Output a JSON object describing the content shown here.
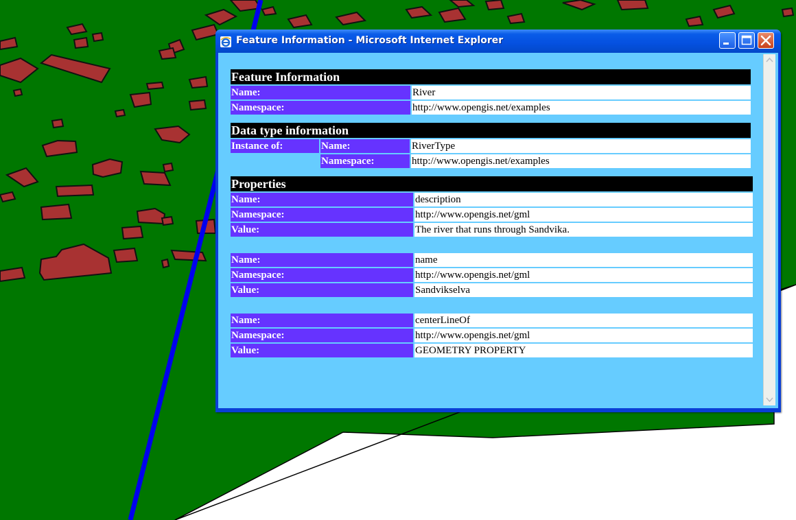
{
  "window": {
    "title": "Feature Information - Microsoft Internet Explorer",
    "icon": "ie-icon",
    "controls": [
      "minimize-icon",
      "maximize-icon",
      "close-icon"
    ]
  },
  "feature_info": {
    "header": "Feature Information",
    "name_label": "Name:",
    "name_value": "River",
    "namespace_label": "Namespace:",
    "namespace_value": "http://www.opengis.net/examples"
  },
  "data_type": {
    "header": "Data type information",
    "instance_label": "Instance of:",
    "name_label": "Name:",
    "name_value": "RiverType",
    "namespace_label": "Namespace:",
    "namespace_value": "http://www.opengis.net/examples"
  },
  "properties": {
    "header": "Properties",
    "items": [
      {
        "name_label": "Name:",
        "name": "description",
        "namespace_label": "Namespace:",
        "namespace": "http://www.opengis.net/gml",
        "value_label": "Value:",
        "value": "The river that runs through Sandvika."
      },
      {
        "name_label": "Name:",
        "name": "name",
        "namespace_label": "Namespace:",
        "namespace": "http://www.opengis.net/gml",
        "value_label": "Value:",
        "value": "Sandvikselva"
      },
      {
        "name_label": "Name:",
        "name": "centerLineOf",
        "namespace_label": "Namespace:",
        "namespace": "http://www.opengis.net/gml",
        "value_label": "Value:",
        "value": "GEOMETRY PROPERTY"
      }
    ]
  },
  "colors": {
    "map_ground": "#007700",
    "buildings": "#a83232",
    "river": "#0000ee",
    "page_background": "#66ccff",
    "label_cell": "#6633ff",
    "header_cell": "#000000"
  }
}
